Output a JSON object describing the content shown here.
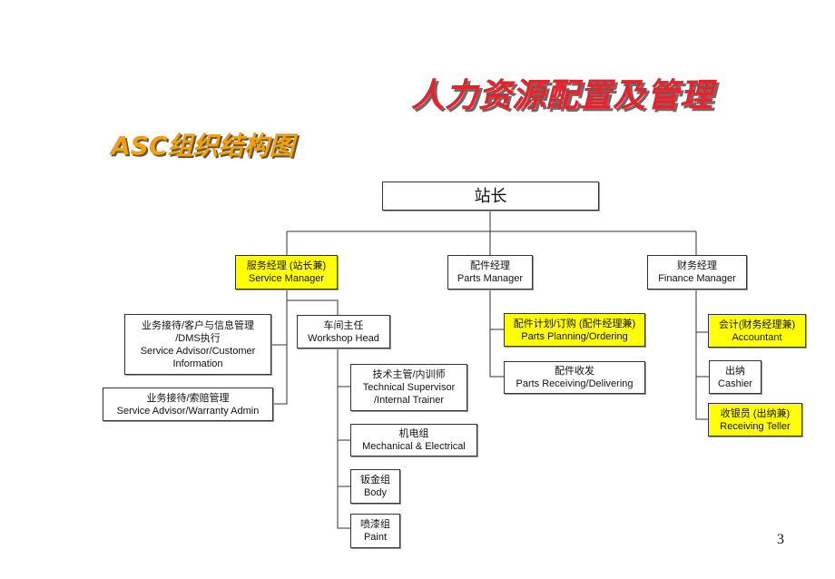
{
  "title": "人力资源配置及管理",
  "subtitle": "ASC组织结构图",
  "page_number": "3",
  "colors": {
    "title": "#e8212a",
    "subtitle": "#f7a100",
    "highlight": "#ffff00"
  },
  "org": {
    "root": {
      "zh": "站长"
    },
    "service_manager": {
      "zh": "服务经理 (站长兼)",
      "en": "Service Manager",
      "highlight": true
    },
    "parts_manager": {
      "zh": "配件经理",
      "en": "Parts Manager"
    },
    "finance_manager": {
      "zh": "财务经理",
      "en": "Finance Manager"
    },
    "service_advisor_customer": {
      "zh1": "业务接待/客户与信息管理",
      "zh2": "/DMS执行",
      "en1": "Service Advisor/Customer",
      "en2": "Information"
    },
    "service_advisor_warranty": {
      "zh": "业务接待/索赔管理",
      "en": "Service Advisor/Warranty Admin"
    },
    "workshop_head": {
      "zh": "车间主任",
      "en": "Workshop Head"
    },
    "technical_supervisor": {
      "zh": "技术主管/内训师",
      "en1": "Technical Supervisor",
      "en2": "/Internal Trainer"
    },
    "mechanical": {
      "zh": "机电组",
      "en": "Mechanical & Electrical"
    },
    "body": {
      "zh": "钣金组",
      "en": "Body"
    },
    "paint": {
      "zh": "喷漆组",
      "en": "Paint"
    },
    "parts_planning": {
      "zh": "配件计划/订购 (配件经理兼)",
      "en": "Parts Planning/Ordering",
      "highlight": true
    },
    "parts_receiving": {
      "zh": "配件收发",
      "en": "Parts Receiving/Delivering"
    },
    "accountant": {
      "zh": "会计(财务经理兼)",
      "en": "Accountant",
      "highlight": true
    },
    "cashier": {
      "zh": "出纳",
      "en": "Cashier"
    },
    "receiving_teller": {
      "zh": "收银员 (出纳兼)",
      "en": "Receiving Teller",
      "highlight": true
    }
  }
}
